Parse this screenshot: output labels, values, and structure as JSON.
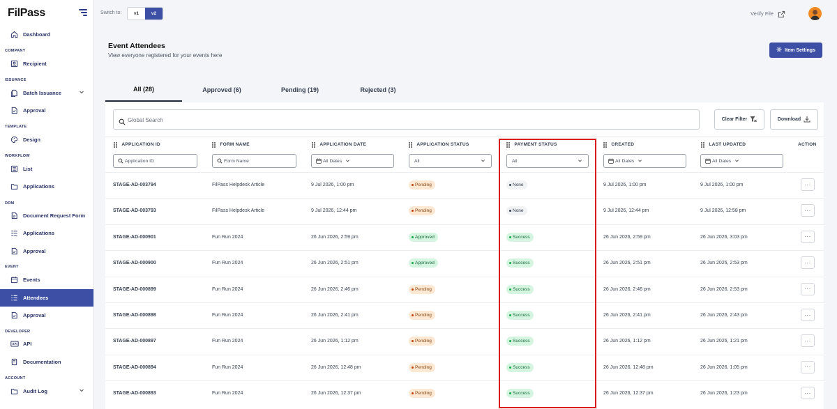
{
  "app": {
    "logo": "FilPass"
  },
  "sidebar": {
    "sections": {
      "company": "COMPANY",
      "issuance": "ISSUANCE",
      "template": "TEMPLATE",
      "workflow": "WORKFLOW",
      "drm": "DRM",
      "event": "EVENT",
      "developer": "DEVELOPER",
      "account": "ACCOUNT"
    },
    "items": {
      "dashboard": "Dashboard",
      "recipient": "Recipient",
      "batch_issuance": "Batch Issuance",
      "issuance_approval": "Approval",
      "design": "Design",
      "list": "List",
      "workflow_applications": "Applications",
      "document_request_form": "Document Request Form",
      "drm_applications": "Applications",
      "drm_approval": "Approval",
      "events": "Events",
      "attendees": "Attendees",
      "event_approval": "Approval",
      "api": "API",
      "documentation": "Documentation",
      "audit_log": "Audit Log"
    }
  },
  "topbar": {
    "switch_label": "Switch to:",
    "v1": "v1",
    "v2": "v2",
    "verify_file": "Verify File"
  },
  "header": {
    "title": "Event Attendees",
    "subtitle": "View everyone registered for your events here",
    "settings_button": "Item Settings"
  },
  "tabs": [
    {
      "label": "All (28)",
      "active": true
    },
    {
      "label": "Approved (6)"
    },
    {
      "label": "Pending (19)"
    },
    {
      "label": "Rejected (3)"
    }
  ],
  "toolbar": {
    "search_placeholder": "Global Search",
    "clear_filter": "Clear Filter",
    "download": "Download"
  },
  "table": {
    "columns": {
      "application_id": "APPLICATION ID",
      "form_name": "FORM NAME",
      "application_date": "APPLICATION DATE",
      "application_status": "APPLICATION STATUS",
      "payment_status": "PAYMENT STATUS",
      "created": "CREATED",
      "last_updated": "LAST UPDATED",
      "action": "ACTION"
    },
    "filters": {
      "application_id": "Application ID",
      "form_name": "Form Name",
      "application_date": "All Dates",
      "application_status": "All",
      "payment_status": "All",
      "created": "All Dates",
      "last_updated": "All Dates"
    },
    "action_label": "···",
    "rows": [
      {
        "id": "STAGE-AD-003794",
        "form": "FilPass Helpdesk Article",
        "date": "9 Jul 2026, 1:00 pm",
        "status": "Pending",
        "payment": "None",
        "created": "9 Jul 2026, 1:00 pm",
        "updated": "9 Jul 2026, 1:00 pm"
      },
      {
        "id": "STAGE-AD-003793",
        "form": "FilPass Helpdesk Article",
        "date": "9 Jul 2026, 12:44 pm",
        "status": "Pending",
        "payment": "None",
        "created": "9 Jul 2026, 12:44 pm",
        "updated": "9 Jul 2026, 12:58 pm"
      },
      {
        "id": "STAGE-AD-000901",
        "form": "Fun Run 2024",
        "date": "26 Jun 2026, 2:59 pm",
        "status": "Approved",
        "payment": "Success",
        "created": "26 Jun 2026, 2:59 pm",
        "updated": "26 Jun 2026, 3:03 pm"
      },
      {
        "id": "STAGE-AD-000900",
        "form": "Fun Run 2024",
        "date": "26 Jun 2026, 2:51 pm",
        "status": "Approved",
        "payment": "Success",
        "created": "26 Jun 2026, 2:51 pm",
        "updated": "26 Jun 2026, 2:53 pm"
      },
      {
        "id": "STAGE-AD-000899",
        "form": "Fun Run 2024",
        "date": "26 Jun 2026, 2:46 pm",
        "status": "Pending",
        "payment": "Success",
        "created": "26 Jun 2026, 2:46 pm",
        "updated": "26 Jun 2026, 2:53 pm"
      },
      {
        "id": "STAGE-AD-000898",
        "form": "Fun Run 2024",
        "date": "26 Jun 2026, 2:41 pm",
        "status": "Pending",
        "payment": "Success",
        "created": "26 Jun 2026, 2:41 pm",
        "updated": "26 Jun 2026, 2:43 pm"
      },
      {
        "id": "STAGE-AD-000897",
        "form": "Fun Run 2024",
        "date": "26 Jun 2026, 1:12 pm",
        "status": "Pending",
        "payment": "Success",
        "created": "26 Jun 2026, 1:12 pm",
        "updated": "26 Jun 2026, 1:21 pm"
      },
      {
        "id": "STAGE-AD-000894",
        "form": "Fun Run 2024",
        "date": "26 Jun 2026, 12:48 pm",
        "status": "Pending",
        "payment": "Success",
        "created": "26 Jun 2026, 12:48 pm",
        "updated": "26 Jun 2026, 1:05 pm"
      },
      {
        "id": "STAGE-AD-000893",
        "form": "Fun Run 2024",
        "date": "26 Jun 2026, 12:37 pm",
        "status": "Pending",
        "payment": "Success",
        "created": "26 Jun 2026, 12:37 pm",
        "updated": "26 Jun 2026, 1:23 pm"
      }
    ]
  },
  "colors": {
    "primary": "#3c4fa5",
    "highlight": "#d91c1c"
  }
}
